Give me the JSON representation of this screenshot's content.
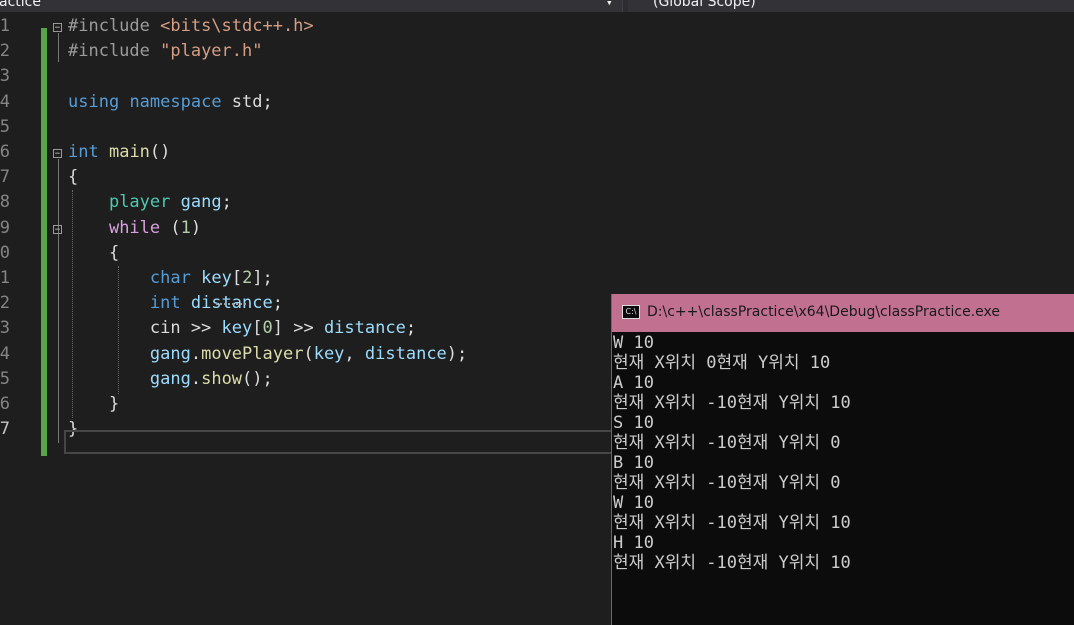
{
  "toolbar": {
    "project_dropdown": "actice",
    "scope_dropdown": "(Global Scope)"
  },
  "editor": {
    "lines": [
      {
        "num": "1",
        "tokens": [
          {
            "t": "#include ",
            "c": "pp"
          },
          {
            "t": "<bits\\stdc++.h>",
            "c": "str"
          }
        ]
      },
      {
        "num": "2",
        "tokens": [
          {
            "t": "#include ",
            "c": "pp"
          },
          {
            "t": "\"player.h\"",
            "c": "str"
          }
        ]
      },
      {
        "num": "3",
        "tokens": []
      },
      {
        "num": "4",
        "tokens": [
          {
            "t": "using",
            "c": "kw"
          },
          {
            "t": " ",
            "c": ""
          },
          {
            "t": "namespace",
            "c": "kw"
          },
          {
            "t": " std;",
            "c": ""
          }
        ]
      },
      {
        "num": "5",
        "tokens": []
      },
      {
        "num": "6",
        "tokens": [
          {
            "t": "int",
            "c": "kw"
          },
          {
            "t": " ",
            "c": ""
          },
          {
            "t": "main",
            "c": "fn"
          },
          {
            "t": "()",
            "c": ""
          }
        ]
      },
      {
        "num": "7",
        "tokens": [
          {
            "t": "{",
            "c": ""
          }
        ]
      },
      {
        "num": "8",
        "tokens": [
          {
            "t": "    ",
            "c": ""
          },
          {
            "t": "player",
            "c": "typ"
          },
          {
            "t": " ",
            "c": ""
          },
          {
            "t": "gang",
            "c": "var"
          },
          {
            "t": ";",
            "c": ""
          }
        ]
      },
      {
        "num": "9",
        "tokens": [
          {
            "t": "    ",
            "c": ""
          },
          {
            "t": "while",
            "c": "ctl"
          },
          {
            "t": " (",
            "c": ""
          },
          {
            "t": "1",
            "c": "num"
          },
          {
            "t": ")",
            "c": ""
          }
        ]
      },
      {
        "num": "0",
        "tokens": [
          {
            "t": "    {",
            "c": ""
          }
        ]
      },
      {
        "num": "1",
        "tokens": [
          {
            "t": "        ",
            "c": ""
          },
          {
            "t": "char",
            "c": "kw"
          },
          {
            "t": " ",
            "c": ""
          },
          {
            "t": "key",
            "c": "var"
          },
          {
            "t": "[",
            "c": ""
          },
          {
            "t": "2",
            "c": "num"
          },
          {
            "t": "];",
            "c": ""
          }
        ]
      },
      {
        "num": "2",
        "tokens": [
          {
            "t": "        ",
            "c": ""
          },
          {
            "t": "int",
            "c": "kw"
          },
          {
            "t": " ",
            "c": ""
          },
          {
            "t": "distance",
            "c": "var"
          },
          {
            "t": ";",
            "c": ""
          }
        ]
      },
      {
        "num": "3",
        "tokens": [
          {
            "t": "        cin >> ",
            "c": ""
          },
          {
            "t": "key",
            "c": "var"
          },
          {
            "t": "[",
            "c": ""
          },
          {
            "t": "0",
            "c": "num"
          },
          {
            "t": "] >> ",
            "c": ""
          },
          {
            "t": "distance",
            "c": "var"
          },
          {
            "t": ";",
            "c": ""
          }
        ]
      },
      {
        "num": "4",
        "tokens": [
          {
            "t": "        ",
            "c": ""
          },
          {
            "t": "gang",
            "c": "var"
          },
          {
            "t": ".",
            "c": ""
          },
          {
            "t": "movePlayer",
            "c": "fn"
          },
          {
            "t": "(",
            "c": ""
          },
          {
            "t": "key",
            "c": "var"
          },
          {
            "t": ", ",
            "c": ""
          },
          {
            "t": "distance",
            "c": "var"
          },
          {
            "t": ");",
            "c": ""
          }
        ]
      },
      {
        "num": "5",
        "tokens": [
          {
            "t": "        ",
            "c": ""
          },
          {
            "t": "gang",
            "c": "var"
          },
          {
            "t": ".",
            "c": ""
          },
          {
            "t": "show",
            "c": "fn"
          },
          {
            "t": "();",
            "c": ""
          }
        ]
      },
      {
        "num": "6",
        "tokens": [
          {
            "t": "    }",
            "c": ""
          }
        ]
      },
      {
        "num": "7",
        "tokens": [
          {
            "t": "}",
            "c": ""
          }
        ]
      }
    ]
  },
  "console": {
    "title": "D:\\c++\\classPractice\\x64\\Debug\\classPractice.exe",
    "icon": "console-app-icon",
    "icon_text": "C:\\",
    "lines": [
      "W 10",
      "현재 X위치 0현재 Y위치 10",
      "A 10",
      "현재 X위치 -10현재 Y위치 10",
      "S 10",
      "현재 X위치 -10현재 Y위치 0",
      "B 10",
      "현재 X위치 -10현재 Y위치 0",
      "W 10",
      "현재 X위치 -10현재 Y위치 10",
      "H 10",
      "현재 X위치 -10현재 Y위치 10"
    ]
  },
  "colors": {
    "editor_bg": "#1e1e1e",
    "change_bar": "#57a64a",
    "console_title_bg": "#c1708f",
    "console_bg": "#0c0c0c"
  }
}
